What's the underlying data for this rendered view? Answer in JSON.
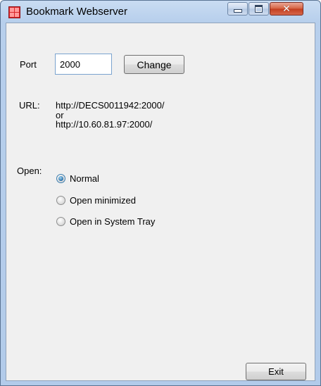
{
  "window": {
    "title": "Bookmark Webserver",
    "close_glyph": "✕"
  },
  "port": {
    "label": "Port",
    "value": "2000",
    "change_label": "Change"
  },
  "url": {
    "label": "URL:",
    "line1": "http://DECS0011942:2000/",
    "separator": "or",
    "line2": "http://10.60.81.97:2000/"
  },
  "open": {
    "label": "Open:",
    "options": [
      {
        "label": "Normal",
        "checked": true
      },
      {
        "label": "Open minimized",
        "checked": false
      },
      {
        "label": "Open in System Tray",
        "checked": false
      }
    ]
  },
  "footer": {
    "exit_label": "Exit"
  },
  "icons": {
    "app": "app-logo-icon",
    "minimize": "minimize-icon",
    "maximize": "maximize-icon",
    "close": "close-icon"
  }
}
